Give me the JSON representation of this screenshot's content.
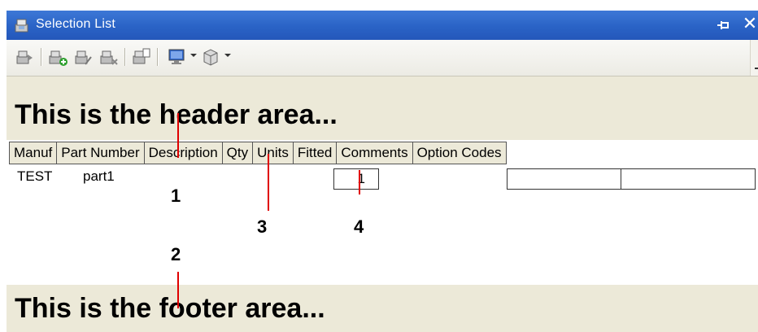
{
  "window": {
    "title": "Selection List",
    "pin_glyph": "⊣",
    "close_glyph": "✕",
    "accent": "#2a63c6"
  },
  "toolbar": {
    "icons": [
      "transfer-icon",
      "add-part-icon",
      "edit-part-icon",
      "remove-part-icon",
      "copy-list-icon",
      "monitor-dropdown-icon",
      "box-dropdown-icon"
    ]
  },
  "header_area": {
    "text": "This is the header area..."
  },
  "columns": [
    "Manuf",
    "Part Number",
    "Description",
    "Qty",
    "Units",
    "Fitted",
    "Comments",
    "Option Codes"
  ],
  "row": {
    "manuf": "TEST",
    "part_number": "part1",
    "description": "",
    "qty": "1",
    "comments": "",
    "option_codes": ""
  },
  "footer_area": {
    "text": "This is the footer area..."
  },
  "annotations": {
    "label_1": "1",
    "label_2": "2",
    "label_3": "3",
    "label_4": "4",
    "line_color": "#e00000"
  }
}
